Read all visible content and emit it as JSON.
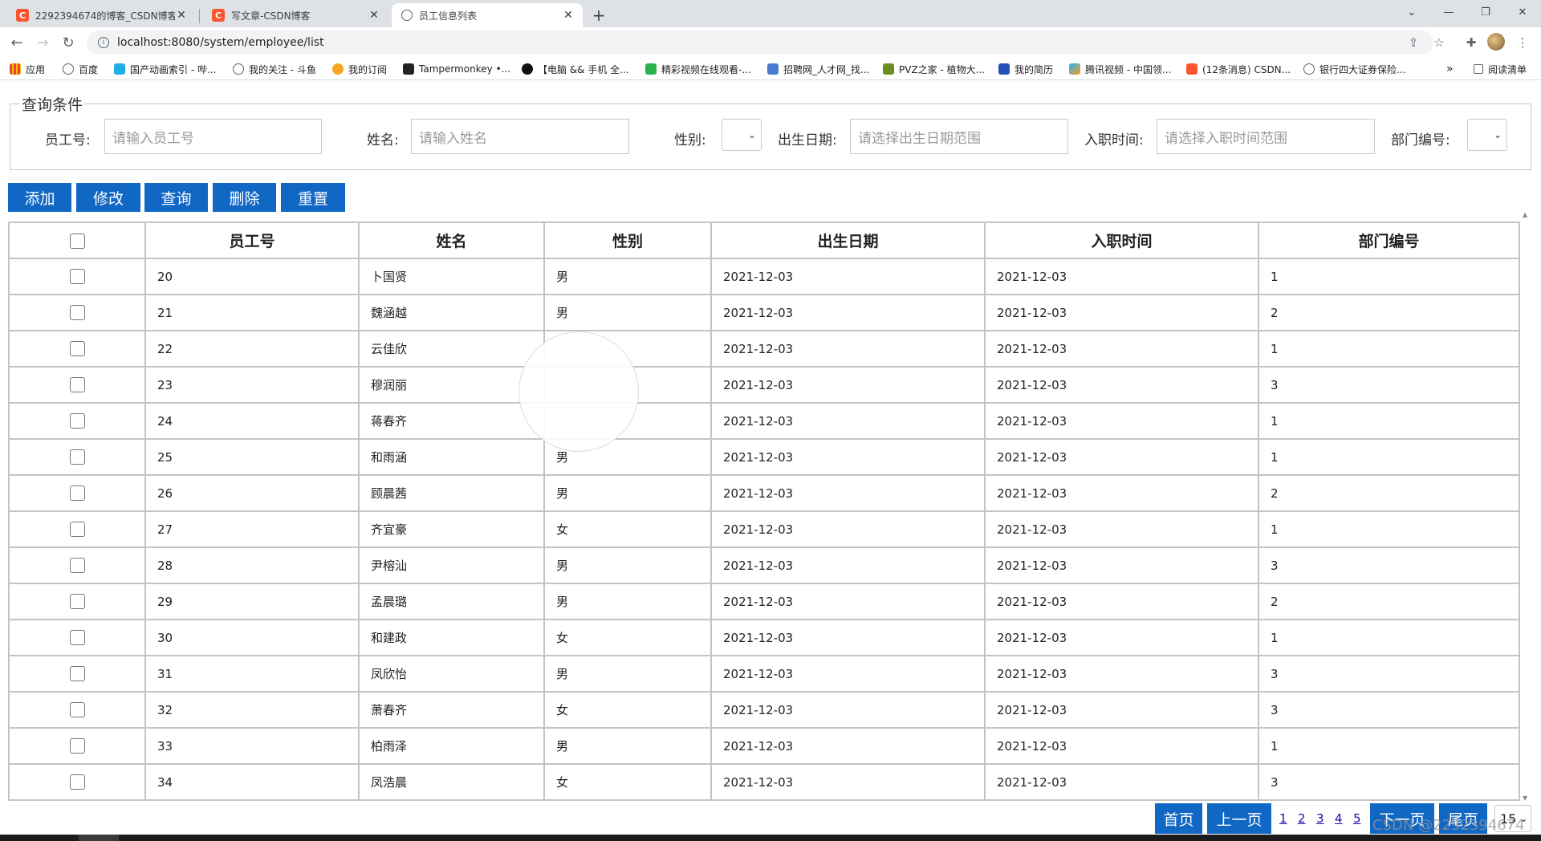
{
  "browser": {
    "tabs": [
      {
        "title": "2292394674的博客_CSDN博客",
        "active": false
      },
      {
        "title": "写文章-CSDN博客",
        "active": false
      },
      {
        "title": "员工信息列表",
        "active": true
      }
    ],
    "url": "localhost:8080/system/employee/list",
    "bookmarks": [
      "应用",
      "百度",
      "国产动画索引 - 哔...",
      "我的关注 - 斗鱼",
      "我的订阅",
      "Tampermonkey •...",
      "【电脑 && 手机 全...",
      "精彩视频在线观看-...",
      "招聘网_人才网_找...",
      "PVZ之家 - 植物大...",
      "我的简历",
      "腾讯视频 - 中国领...",
      "(12条消息) CSDN...",
      "银行四大证券保险..."
    ],
    "reading_list": "阅读清单",
    "more_bookmarks": "»"
  },
  "query": {
    "legend": "查询条件",
    "employee_no_label": "员工号:",
    "employee_no_placeholder": "请输入员工号",
    "name_label": "姓名:",
    "name_placeholder": "请输入姓名",
    "gender_label": "性别:",
    "birth_label": "出生日期:",
    "birth_placeholder": "请选择出生日期范围",
    "hire_label": "入职时间:",
    "hire_placeholder": "请选择入职时间范围",
    "dept_label": "部门编号:"
  },
  "actions": {
    "add": "添加",
    "edit": "修改",
    "search": "查询",
    "delete": "删除",
    "reset": "重置"
  },
  "table": {
    "headers": [
      "员工号",
      "姓名",
      "性别",
      "出生日期",
      "入职时间",
      "部门编号"
    ],
    "rows": [
      {
        "id": "20",
        "name": "卜国贤",
        "gender": "男",
        "birth": "2021-12-03",
        "hire": "2021-12-03",
        "dept": "1"
      },
      {
        "id": "21",
        "name": "魏涵越",
        "gender": "男",
        "birth": "2021-12-03",
        "hire": "2021-12-03",
        "dept": "2"
      },
      {
        "id": "22",
        "name": "云佳欣",
        "gender": "",
        "birth": "2021-12-03",
        "hire": "2021-12-03",
        "dept": "1"
      },
      {
        "id": "23",
        "name": "穆润丽",
        "gender": "",
        "birth": "2021-12-03",
        "hire": "2021-12-03",
        "dept": "3"
      },
      {
        "id": "24",
        "name": "蒋春齐",
        "gender": "",
        "birth": "2021-12-03",
        "hire": "2021-12-03",
        "dept": "1"
      },
      {
        "id": "25",
        "name": "和雨涵",
        "gender": "男",
        "birth": "2021-12-03",
        "hire": "2021-12-03",
        "dept": "1"
      },
      {
        "id": "26",
        "name": "顾晨茜",
        "gender": "男",
        "birth": "2021-12-03",
        "hire": "2021-12-03",
        "dept": "2"
      },
      {
        "id": "27",
        "name": "齐宜豪",
        "gender": "女",
        "birth": "2021-12-03",
        "hire": "2021-12-03",
        "dept": "1"
      },
      {
        "id": "28",
        "name": "尹榕汕",
        "gender": "男",
        "birth": "2021-12-03",
        "hire": "2021-12-03",
        "dept": "3"
      },
      {
        "id": "29",
        "name": "孟晨璐",
        "gender": "男",
        "birth": "2021-12-03",
        "hire": "2021-12-03",
        "dept": "2"
      },
      {
        "id": "30",
        "name": "和建政",
        "gender": "女",
        "birth": "2021-12-03",
        "hire": "2021-12-03",
        "dept": "1"
      },
      {
        "id": "31",
        "name": "凤欣怡",
        "gender": "男",
        "birth": "2021-12-03",
        "hire": "2021-12-03",
        "dept": "3"
      },
      {
        "id": "32",
        "name": "萧春齐",
        "gender": "女",
        "birth": "2021-12-03",
        "hire": "2021-12-03",
        "dept": "3"
      },
      {
        "id": "33",
        "name": "柏雨泽",
        "gender": "男",
        "birth": "2021-12-03",
        "hire": "2021-12-03",
        "dept": "1"
      },
      {
        "id": "34",
        "name": "凤浩晨",
        "gender": "女",
        "birth": "2021-12-03",
        "hire": "2021-12-03",
        "dept": "3"
      }
    ]
  },
  "pagination": {
    "first": "首页",
    "prev": "上一页",
    "pages": [
      "1",
      "2",
      "3",
      "4",
      "5"
    ],
    "next": "下一页",
    "last": "尾页",
    "page_size": "15"
  },
  "watermark": "CSDN @2292394674",
  "colors": {
    "primary_button": "#1167c4",
    "csdn_brand": "#fc5531"
  }
}
